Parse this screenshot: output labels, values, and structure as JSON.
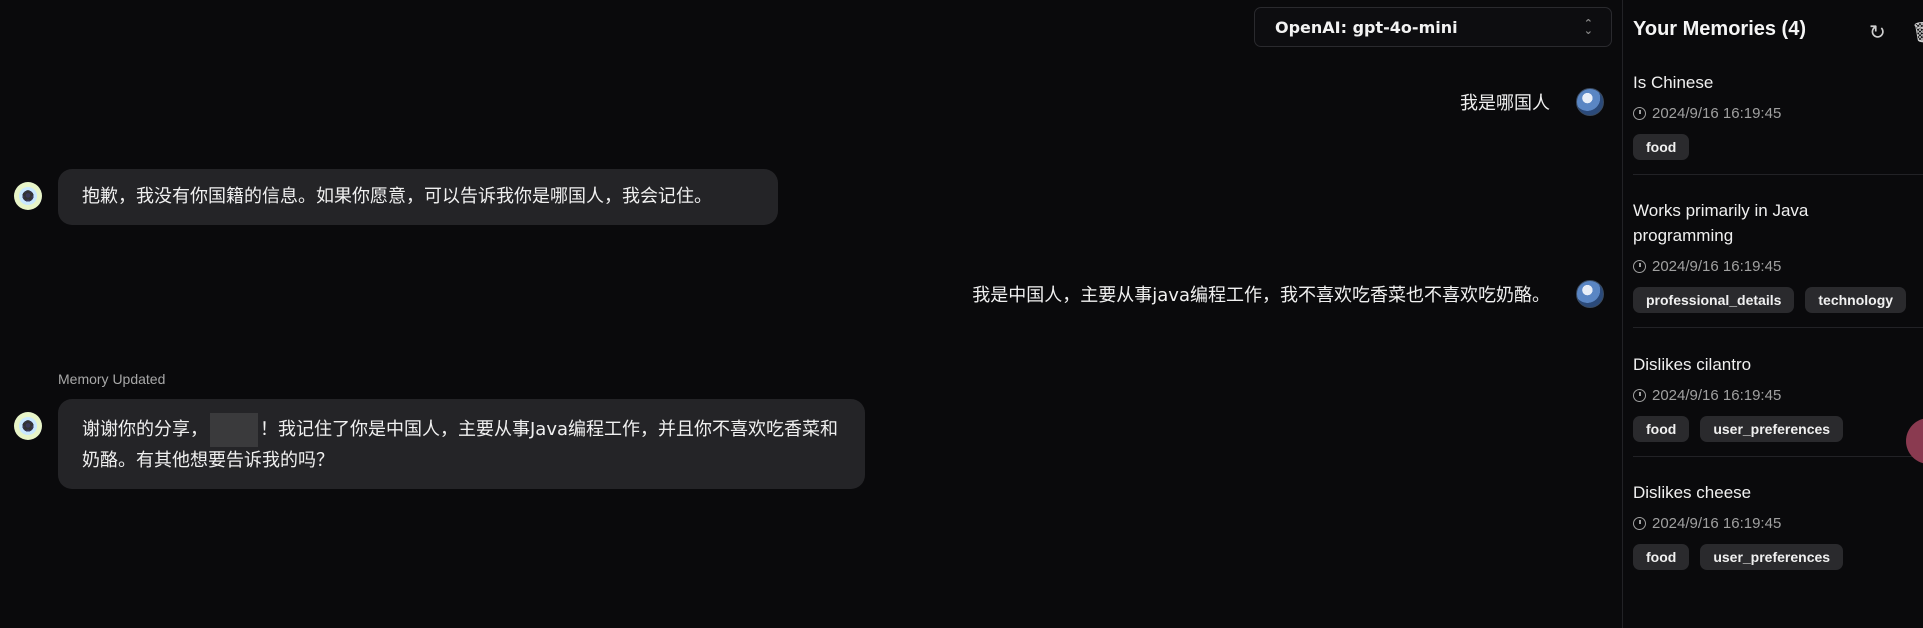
{
  "model_selector": {
    "value": "OpenAI: gpt-4o-mini"
  },
  "messages": [
    {
      "role": "user",
      "text": "我是哪国人"
    },
    {
      "role": "assistant",
      "text": "抱歉，我没有你国籍的信息。如果你愿意，可以告诉我你是哪国人，我会记住。"
    },
    {
      "role": "user",
      "text": "我是中国人，主要从事java编程工作，我不喜欢吃香菜也不喜欢吃奶酪。"
    },
    {
      "role": "assistant",
      "status": "Memory Updated",
      "text_before": "谢谢你的分享，",
      "text_after": "！我记住了你是中国人，主要从事Java编程工作，并且你不喜欢吃香菜和奶酪。有其他想要告诉我的吗？"
    }
  ],
  "sidebar": {
    "title": "Your Memories (4)",
    "memories": [
      {
        "title": "Is Chinese",
        "time": "2024/9/16 16:19:45",
        "tags": [
          "food"
        ]
      },
      {
        "title": "Works primarily in Java programming",
        "time": "2024/9/16 16:19:45",
        "tags": [
          "professional_details",
          "technology"
        ]
      },
      {
        "title": "Dislikes cilantro",
        "time": "2024/9/16 16:19:45",
        "tags": [
          "food",
          "user_preferences"
        ]
      },
      {
        "title": "Dislikes cheese",
        "time": "2024/9/16 16:19:45",
        "tags": [
          "food",
          "user_preferences"
        ]
      }
    ]
  }
}
